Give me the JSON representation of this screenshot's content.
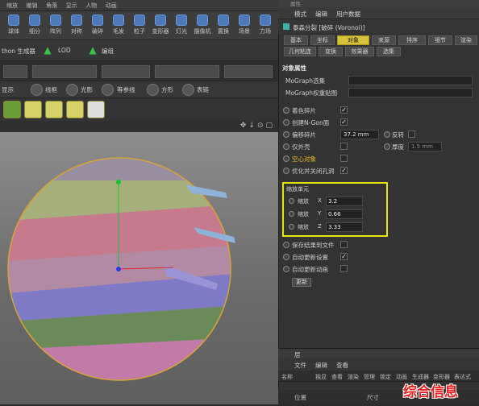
{
  "toolbar": {
    "top_labels": [
      "缩放",
      "撤销",
      "角落",
      "显示",
      "人物",
      "动画"
    ],
    "tools": [
      {
        "label": "球体"
      },
      {
        "label": "细分"
      },
      {
        "label": "阵列"
      },
      {
        "label": "对称"
      },
      {
        "label": "破碎"
      },
      {
        "label": "毛发"
      },
      {
        "label": "粒子"
      },
      {
        "label": "变形器"
      },
      {
        "label": "灯光"
      },
      {
        "label": "摄像机"
      },
      {
        "label": "置换"
      },
      {
        "label": "场景"
      },
      {
        "label": "力场"
      },
      {
        "label": "渲染"
      }
    ],
    "generator_label": "thon 生成器",
    "lod_label": "LOD",
    "field_label": "编组"
  },
  "view_bar": {
    "items": [
      "显示",
      "线框",
      "光影",
      "着色",
      "等参线",
      "方形",
      "表链"
    ]
  },
  "panel": {
    "title": "属性",
    "menu": [
      "模式",
      "编辑",
      "用户数据"
    ],
    "object_name": "泰森分裂 [破碎 (Voronoi)]",
    "tabs_row1": [
      "基本",
      "坐标",
      "对象",
      "来源",
      "排序",
      "细节",
      "渲染"
    ],
    "tabs_row2": [
      "几何粘连",
      "变换",
      "效果器",
      "选集"
    ],
    "active_tab": "对象",
    "section_title": "对象属性",
    "mograph_selection_label": "MoGraph选集",
    "mograph_weight_label": "MoGraph权重贴图",
    "rows": [
      {
        "label": "着色碎片",
        "checked": true
      },
      {
        "label": "创建N-Gon面",
        "checked": true
      },
      {
        "label": "偏移碎片",
        "value": "37.2 mm",
        "extra": "反转"
      },
      {
        "label": "仅外壳",
        "extra": "厚度",
        "extra_value": "1.5 mm"
      },
      {
        "label": "空心对象",
        "checked": false,
        "highlight": true
      },
      {
        "label": "优化并关闭孔洞",
        "checked": true
      }
    ],
    "scale_section": {
      "title": "缩放单元",
      "rows": [
        {
          "label": "缩放",
          "axis": "X",
          "value": "3.2"
        },
        {
          "label": "缩放",
          "axis": "Y",
          "value": "0.66"
        },
        {
          "label": "缩放",
          "axis": "Z",
          "value": "3.33"
        }
      ]
    },
    "bottom_rows": [
      {
        "label": "保存结果到文件",
        "checked": false
      },
      {
        "label": "自动更新设置",
        "checked": true
      },
      {
        "label": "自动更新动画",
        "checked": false
      }
    ],
    "update_button": "更新"
  },
  "layers": {
    "title": "层",
    "menu": [
      "文件",
      "编辑",
      "查看"
    ],
    "columns": [
      "名称",
      "独显",
      "查看",
      "渲染",
      "管理",
      "锁定",
      "动画",
      "生成器",
      "变形器",
      "表达式"
    ],
    "coord_labels": [
      "位置",
      "尺寸"
    ]
  },
  "watermark": "综合信息",
  "colors": {
    "accent": "#d6c23a",
    "highlight_box": "#e6e600",
    "watermark": "#e42020"
  }
}
